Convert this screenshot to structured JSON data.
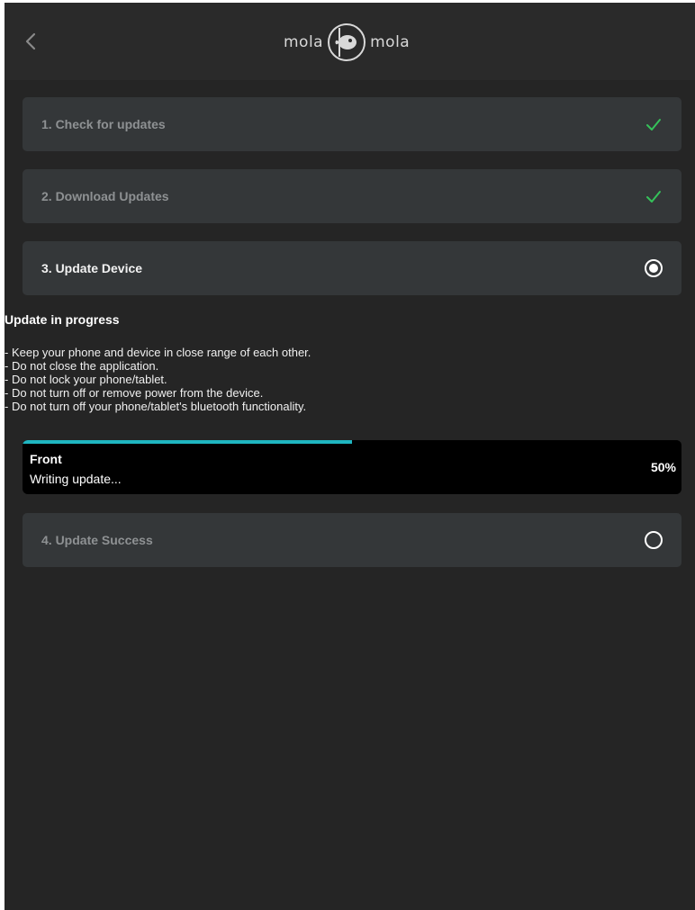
{
  "header": {
    "back_icon": "chevron-left-icon",
    "logo": {
      "left_word": "mola",
      "right_word": "mola",
      "emblem_icon": "sunfish-emblem-icon"
    }
  },
  "steps": [
    {
      "label": "1. Check for updates",
      "status": "complete",
      "status_icon": "check-icon"
    },
    {
      "label": "2. Download Updates",
      "status": "complete",
      "status_icon": "check-icon"
    },
    {
      "label": "3. Update Device",
      "status": "active",
      "status_icon": "radio-selected-icon"
    },
    {
      "label": "4. Update Success",
      "status": "pending",
      "status_icon": "radio-empty-icon"
    }
  ],
  "progress": {
    "title": "Update in progress",
    "instructions": [
      "- Keep your phone and device in close range of each other.",
      "- Do not close the application.",
      "- Do not lock your phone/tablet.",
      "- Do not turn off or remove power from the device.",
      "- Do not turn off your phone/tablet's bluetooth functionality."
    ],
    "device": {
      "name": "Front",
      "status": "Writing update...",
      "percent_label": "50%",
      "progress_fraction": 0.5
    }
  },
  "colors": {
    "background": "#252525",
    "header": "#2a2a2a",
    "step_card": "#343739",
    "check_green": "#35c25a",
    "progress_accent": "#1fb6c1"
  }
}
